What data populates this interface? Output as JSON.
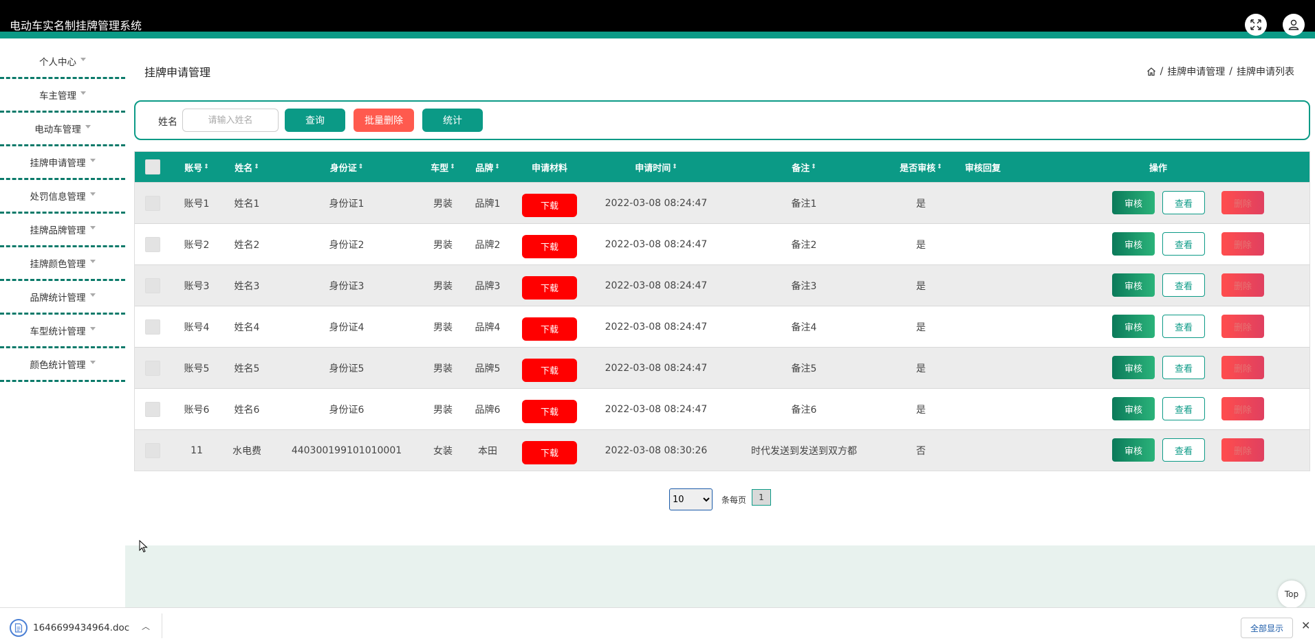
{
  "app": {
    "title": "电动车实名制挂牌管理系统"
  },
  "sidebar": {
    "items": [
      {
        "label": "个人中心"
      },
      {
        "label": "车主管理"
      },
      {
        "label": "电动车管理"
      },
      {
        "label": "挂牌申请管理"
      },
      {
        "label": "处罚信息管理"
      },
      {
        "label": "挂牌品牌管理"
      },
      {
        "label": "挂牌颜色管理"
      },
      {
        "label": "品牌统计管理"
      },
      {
        "label": "车型统计管理"
      },
      {
        "label": "颜色统计管理"
      }
    ]
  },
  "page": {
    "title": "挂牌申请管理"
  },
  "breadcrumb": {
    "sep": "/",
    "level1": "挂牌申请管理",
    "level2": "挂牌申请列表"
  },
  "search": {
    "label": "姓名",
    "placeholder": "请输入姓名",
    "query_btn": "查询",
    "batch_delete_btn": "批量删除",
    "stats_btn": "统计"
  },
  "table": {
    "headers": {
      "account": "账号",
      "name": "姓名",
      "idcard": "身份证",
      "model": "车型",
      "brand": "品牌",
      "material": "申请材料",
      "time": "申请时间",
      "remark": "备注",
      "audited": "是否审核",
      "reply": "审核回复",
      "ops": "操作"
    },
    "sort_icon": "⇕",
    "rows": [
      {
        "account": "账号1",
        "name": "姓名1",
        "idcard": "身份证1",
        "model": "男装",
        "brand": "品牌1",
        "material": "下载",
        "time": "2022-03-08 08:24:47",
        "remark": "备注1",
        "audited": "是",
        "reply": ""
      },
      {
        "account": "账号2",
        "name": "姓名2",
        "idcard": "身份证2",
        "model": "男装",
        "brand": "品牌2",
        "material": "下载",
        "time": "2022-03-08 08:24:47",
        "remark": "备注2",
        "audited": "是",
        "reply": ""
      },
      {
        "account": "账号3",
        "name": "姓名3",
        "idcard": "身份证3",
        "model": "男装",
        "brand": "品牌3",
        "material": "下载",
        "time": "2022-03-08 08:24:47",
        "remark": "备注3",
        "audited": "是",
        "reply": ""
      },
      {
        "account": "账号4",
        "name": "姓名4",
        "idcard": "身份证4",
        "model": "男装",
        "brand": "品牌4",
        "material": "下载",
        "time": "2022-03-08 08:24:47",
        "remark": "备注4",
        "audited": "是",
        "reply": ""
      },
      {
        "account": "账号5",
        "name": "姓名5",
        "idcard": "身份证5",
        "model": "男装",
        "brand": "品牌5",
        "material": "下载",
        "time": "2022-03-08 08:24:47",
        "remark": "备注5",
        "audited": "是",
        "reply": ""
      },
      {
        "account": "账号6",
        "name": "姓名6",
        "idcard": "身份证6",
        "model": "男装",
        "brand": "品牌6",
        "material": "下载",
        "time": "2022-03-08 08:24:47",
        "remark": "备注6",
        "audited": "是",
        "reply": ""
      },
      {
        "account": "11",
        "name": "水电费",
        "idcard": "440300199101010001",
        "model": "女装",
        "brand": "本田",
        "material": "下载",
        "time": "2022-03-08 08:30:26",
        "remark": "时代发送到发送到双方都",
        "audited": "否",
        "reply": ""
      }
    ],
    "actions": {
      "audit": "审核",
      "view": "查看",
      "delete": "删除"
    }
  },
  "pagination": {
    "page_size": "10",
    "page_size_options": [
      "10"
    ],
    "per_page_label": "条每页",
    "current_page": "1"
  },
  "top_button": "Top",
  "downloads": {
    "filename": "1646699434964.doc",
    "show_all": "全部显示",
    "chevron": "︿",
    "close": "✕"
  },
  "colors": {
    "accent": "#0b9a86",
    "danger": "#ff0000",
    "header_bg": "#000000"
  }
}
